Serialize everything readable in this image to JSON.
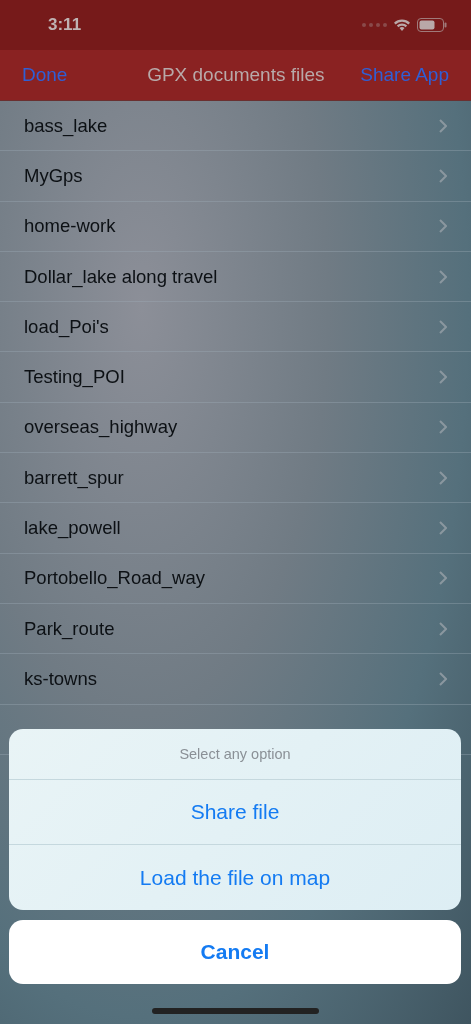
{
  "status_bar": {
    "time": "3:11"
  },
  "nav_bar": {
    "left_button": "Done",
    "title": "GPX documents files",
    "right_button": "Share App"
  },
  "files": [
    "bass_lake",
    "MyGps",
    "home-work",
    "Dollar_lake along travel",
    "load_Poi's",
    "Testing_POI",
    "overseas_highway",
    "barrett_spur",
    "lake_powell",
    "Portobello_Road_way",
    "Park_route",
    "ks-towns"
  ],
  "action_sheet": {
    "title": "Select any option",
    "actions": [
      "Share file",
      "Load the file on map"
    ],
    "cancel": "Cancel"
  }
}
